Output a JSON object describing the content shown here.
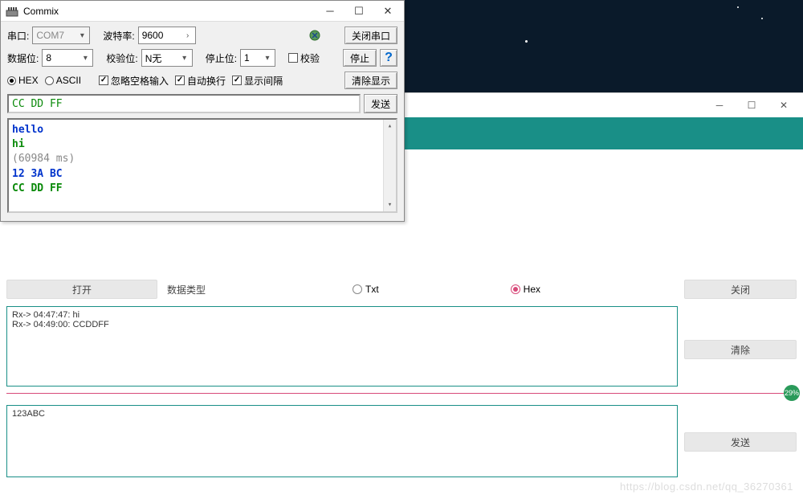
{
  "desktop": {
    "stars": []
  },
  "commix": {
    "title": "Commix",
    "row1": {
      "port_label": "串口:",
      "port_value": "COM7",
      "baud_label": "波特率:",
      "baud_value": "9600",
      "close_port_btn": "关闭串口"
    },
    "row2": {
      "databits_label": "数据位:",
      "databits_value": "8",
      "parity_label": "校验位:",
      "parity_value": "N无",
      "stopbits_label": "停止位:",
      "stopbits_value": "1",
      "check_label": "校验",
      "stop_btn": "停止",
      "help": "?"
    },
    "row3": {
      "hex": "HEX",
      "ascii": "ASCII",
      "ignore_space": "忽略空格输入",
      "auto_wrap": "自动换行",
      "show_gap": "显示间隔",
      "clear_btn": "清除显示"
    },
    "send": {
      "input_value": "CC DD FF",
      "send_btn": "发送"
    },
    "log": [
      {
        "text": "hello",
        "cls": "c-blue"
      },
      {
        "text": "hi",
        "cls": "c-green"
      },
      {
        "text": "(60984 ms)",
        "cls": "c-gray"
      },
      {
        "text": "12 3A BC",
        "cls": "c-blue"
      },
      {
        "text": "CC DD FF",
        "cls": "c-green"
      }
    ]
  },
  "bottom": {
    "open_btn": "打开",
    "data_type_label": "数据类型",
    "txt_label": "Txt",
    "hex_label": "Hex",
    "close_btn": "关闭",
    "rx_lines": [
      "Rx-> 04:47:47: hi",
      "Rx-> 04:49:00: CCDDFF"
    ],
    "clear_btn": "清除",
    "tx_value": "123ABC",
    "send_btn": "发送",
    "badge": "29%"
  },
  "watermark": "https://blog.csdn.net/qq_36270361"
}
